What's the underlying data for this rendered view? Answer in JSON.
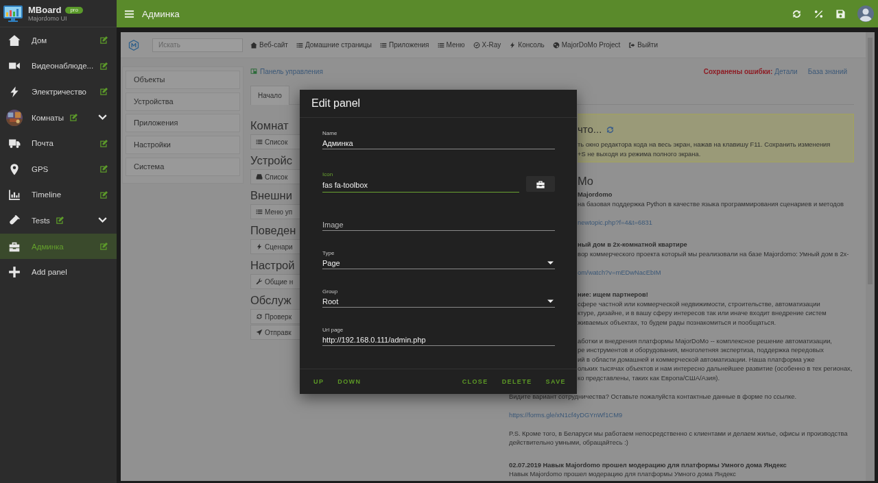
{
  "sidebar": {
    "brand": "MBoard",
    "badge": "pro",
    "subtitle": "Majordomo UI",
    "items": [
      {
        "label": "Дом",
        "kind": "home",
        "selected": false,
        "editable": true,
        "expandable": false
      },
      {
        "label": "Видеонаблюде...",
        "kind": "camera",
        "selected": false,
        "editable": true,
        "expandable": false
      },
      {
        "label": "Электричество",
        "kind": "bolt",
        "selected": false,
        "editable": true,
        "expandable": false
      },
      {
        "label": "Комнаты",
        "kind": "picture",
        "selected": false,
        "editable": true,
        "expandable": true
      },
      {
        "label": "Почта",
        "kind": "truck",
        "selected": false,
        "editable": true,
        "expandable": false
      },
      {
        "label": "GPS",
        "kind": "pin",
        "selected": false,
        "editable": true,
        "expandable": false
      },
      {
        "label": "Timeline",
        "kind": "chart",
        "selected": false,
        "editable": true,
        "expandable": false
      },
      {
        "label": "Tests",
        "kind": "tests",
        "selected": false,
        "editable": true,
        "expandable": true
      },
      {
        "label": "Админка",
        "kind": "toolbox",
        "selected": true,
        "editable": true,
        "expandable": false
      },
      {
        "label": "Add panel",
        "kind": "plus",
        "selected": false,
        "editable": false,
        "expandable": false
      }
    ]
  },
  "topbar": {
    "title": "Админка"
  },
  "toolbar": {
    "search": {
      "placeholder": "Искать"
    },
    "links": [
      {
        "label": "Веб-сайт",
        "kind": "home"
      },
      {
        "label": "Домашние страницы",
        "kind": "list"
      },
      {
        "label": "Приложения",
        "kind": "list"
      },
      {
        "label": "Меню",
        "kind": "list"
      },
      {
        "label": "X-Ray",
        "kind": "xray"
      },
      {
        "label": "Консоль",
        "kind": "bolt"
      },
      {
        "label": "MajorDoMo Project",
        "kind": "globe"
      },
      {
        "label": "Выйти",
        "kind": "exit"
      }
    ]
  },
  "nav": [
    "Объекты",
    "Устройства",
    "Приложения",
    "Настройки",
    "Система"
  ],
  "breadcrumb": "Панель управления",
  "errors": {
    "label": "Сохранены ошибки:",
    "link": "Детали"
  },
  "kb_link": "База знаний",
  "tabs": [
    {
      "label": "Начало",
      "selected": true
    }
  ],
  "sections": [
    {
      "title": "Комнат",
      "buttons": [
        {
          "label": "Список",
          "kind": "list"
        }
      ]
    },
    {
      "title": "Устройс",
      "buttons": [
        {
          "label": "Список",
          "kind": "hdd"
        }
      ]
    },
    {
      "title": "Внешни",
      "buttons": [
        {
          "label": "Меню уп",
          "kind": "list"
        }
      ]
    },
    {
      "title": "Поведен",
      "buttons": [
        {
          "label": "Сценари",
          "kind": "bolt"
        }
      ]
    },
    {
      "title": "Настрой",
      "buttons": [
        {
          "label": "Общие н",
          "kind": "wrench"
        }
      ]
    },
    {
      "title": "Обслуж",
      "buttons": [
        {
          "label": "Проверк",
          "kind": "refresh"
        },
        {
          "label": "Отправк",
          "kind": "send"
        }
      ]
    }
  ],
  "notice": {
    "title": "что...",
    "lines": [
      "ть окно редактора кода на весь экран, нажав на клавишу F11. Сохранить изменения",
      "+S не выходя из режима полного экрана."
    ]
  },
  "news": {
    "title": "Mo",
    "beside": [
      {
        "kind": "title",
        "lines": [
          "Majordomo"
        ]
      },
      {
        "kind": "text",
        "lines": [
          "на базовая поддержка Python в качестве языка программирования сценариев и методов"
        ]
      },
      {
        "kind": "link",
        "lines": [
          "newtopic.php?f=4&t=6831"
        ]
      },
      {
        "kind": "title",
        "lines": [
          "ный дом в 2х-комнатной квартире"
        ]
      },
      {
        "kind": "text",
        "lines": [
          "вор коммерческого проекта который мы реализовали на базе Majordomo: Умный дом в 2х-"
        ]
      },
      {
        "kind": "link",
        "lines": [
          "om/watch?v=mEDwNacEbIM"
        ]
      },
      {
        "kind": "title",
        "lines": [
          "ние: ищем партнеров!"
        ]
      },
      {
        "kind": "text",
        "lines": [
          "сфере частной или коммерческой недвижимости, строительстве, автоматизации",
          "ктуре, дизайне, и в вашу сферу интересов так или иначе входит внедрение систем",
          "живаемых объектах, то будем рады познакомиться и пообщаться."
        ]
      },
      {
        "kind": "text",
        "lines": [
          "аботки и внедрения платформы MajorDoMo -- комплексное решение автоматизации,",
          "ре инструментов и оборудования, многолетняя экспертиза, поддержка передовых",
          "ий в области домашней и коммерческой автоматизации. Наша платформа уже",
          "ольких тысячах объектов и нам интересно дальнейшее развитие (особенно в тех регионах,",
          "ко представлены, таких как Европа/США/Азия)."
        ]
      }
    ],
    "full": [
      {
        "kind": "text",
        "lines": [
          "Видите вариант сотрудничества? Оставьте пожалуйста контактные данные в форме по ссылке."
        ]
      },
      {
        "kind": "link",
        "lines": [
          "https://forms.gle/xN1cf4yDGYnWf1CM9"
        ]
      },
      {
        "kind": "text",
        "lines": [
          "P.S. Кроме того, в Беларуси мы работаем непосредственно с клиентами и делаем жилье, офисы и производства",
          "действительно умными, обращайтесь :)"
        ]
      },
      {
        "kind": "title",
        "lines": [
          "02.07.2019 Навык Majordomo прошел модерацию для платформы Умного дома Яндекс"
        ]
      },
      {
        "kind": "text",
        "lines": [
          "Навык Majordomo прошел модерацию для платформы Умного дома Яндекс"
        ]
      }
    ]
  },
  "modal": {
    "title": "Edit panel",
    "fields": [
      {
        "kind": "text",
        "label": "Name",
        "value": "Админка",
        "focused": false
      },
      {
        "kind": "icon",
        "label": "Icon",
        "value": "fas fa-toolbox",
        "focused": true
      },
      {
        "kind": "text",
        "placeholder": "Image",
        "focused": false
      },
      {
        "kind": "select",
        "label": "Type",
        "value": "Page",
        "focused": false
      },
      {
        "kind": "select",
        "label": "Group",
        "value": "Root",
        "focused": false
      },
      {
        "kind": "text",
        "label": "Url page",
        "value": "http://192.168.0.111/admin.php",
        "focused": false
      }
    ],
    "left_actions": [
      "UP",
      "DOWN"
    ],
    "right_actions": [
      "CLOSE",
      "DELETE",
      "SAVE"
    ]
  }
}
